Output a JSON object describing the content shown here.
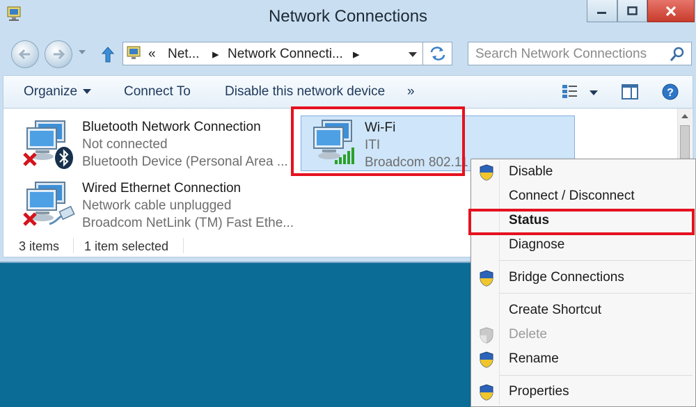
{
  "window": {
    "title": "Network Connections"
  },
  "address_bar": {
    "overflow": "«",
    "crumbs": [
      "Net...",
      "Network Connecti..."
    ]
  },
  "search": {
    "placeholder": "Search Network Connections"
  },
  "command_bar": {
    "organize": "Organize",
    "connect_to": "Connect To",
    "disable_device": "Disable this network device",
    "more": "»"
  },
  "items": [
    {
      "name": "Bluetooth Network Connection",
      "status": "Not connected",
      "device": "Bluetooth Device (Personal Area ..."
    },
    {
      "name": "Wired Ethernet Connection",
      "status": "Network cable unplugged",
      "device": "Broadcom NetLink (TM) Fast Ethe..."
    },
    {
      "name": "Wi-Fi",
      "status": "ITI",
      "device": "Broadcom 802.11"
    }
  ],
  "status_bar": {
    "count": "3 items",
    "selection": "1 item selected"
  },
  "context_menu": {
    "items": [
      "Disable",
      "Connect / Disconnect",
      "Status",
      "Diagnose",
      "Bridge Connections",
      "Create Shortcut",
      "Delete",
      "Rename",
      "Properties"
    ]
  },
  "colors": {
    "desktop": "#0b6d96",
    "highlight_red": "#e5121f",
    "selection_blue": "#cfe6fa"
  },
  "icons": [
    "computer-icon",
    "back-arrow-icon",
    "forward-arrow-icon",
    "up-arrow-icon",
    "refresh-icon",
    "search-icon",
    "network-adapter-icon",
    "bluetooth-icon",
    "ethernet-cable-icon",
    "red-x-icon",
    "signal-bars-icon",
    "uac-shield-icon",
    "help-icon",
    "preview-pane-icon",
    "change-view-icon"
  ]
}
